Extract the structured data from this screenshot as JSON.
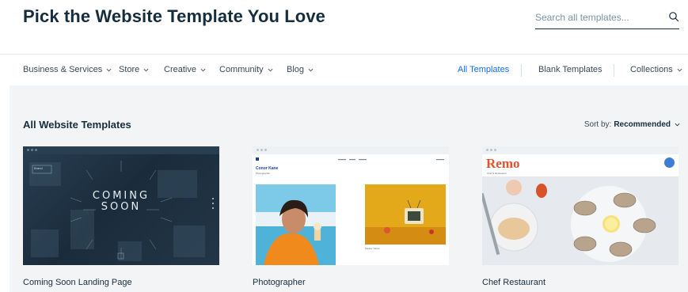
{
  "header": {
    "title": "Pick the Website Template You Love",
    "search_placeholder": "Search all templates..."
  },
  "nav": {
    "categories": [
      {
        "label": "Business & Services"
      },
      {
        "label": "Store"
      },
      {
        "label": "Creative"
      },
      {
        "label": "Community"
      },
      {
        "label": "Blog"
      }
    ],
    "all_templates": "All Templates",
    "blank_templates": "Blank Templates",
    "collections": "Collections"
  },
  "main": {
    "section_title": "All Website Templates",
    "sort_label": "Sort by:",
    "sort_value": "Recommended"
  },
  "templates": [
    {
      "name": "Coming Soon Landing Page",
      "headline_1": "COMING",
      "headline_2": "SOON",
      "logo_text": "Brand"
    },
    {
      "name": "Photographer",
      "site_title": "Conor Kane",
      "site_subtitle": "Photographer",
      "caption": "Mellow Yellow"
    },
    {
      "name": "Chef Restaurant",
      "site_title": "Remo",
      "site_subtitle": "Chef & Restaurant"
    }
  ],
  "colors": {
    "accent": "#116dff",
    "text_dark": "#162d3d",
    "background_gray": "#f3f4f5",
    "remo_orange": "#e0542f"
  }
}
